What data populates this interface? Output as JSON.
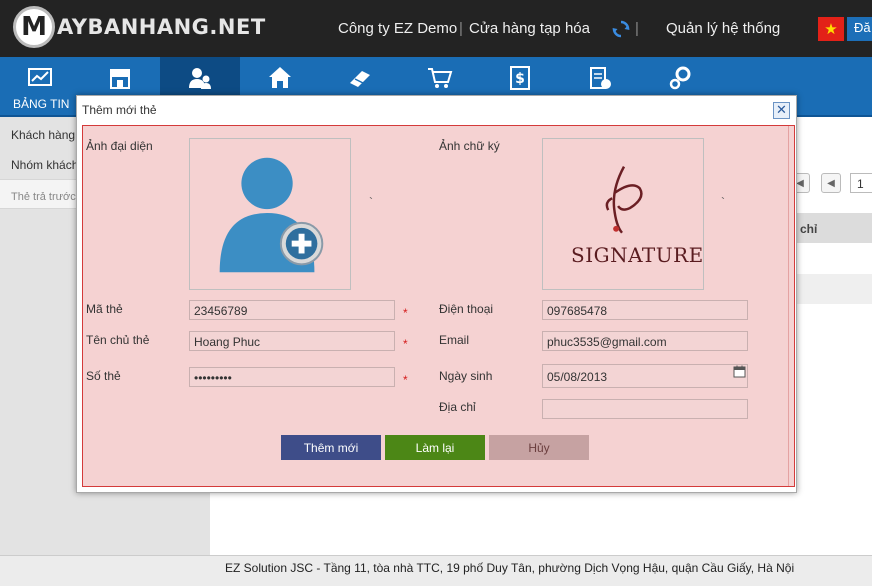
{
  "header": {
    "logo_m": "M",
    "logo_text": "AYBANHANG.NET",
    "company": "Công ty EZ Demo",
    "store": "Cửa hàng tạp hóa",
    "admin": "Quản lý hệ thống",
    "separator": "|",
    "login_label": "Đă"
  },
  "nav": {
    "first_label": "BẢNG TIN",
    "icons": [
      "dashboard-icon",
      "store-icon",
      "customers-icon",
      "home-icon",
      "products-icon",
      "cart-icon",
      "money-icon",
      "report-icon",
      "settings-icon"
    ]
  },
  "sidebar": {
    "items": [
      "Khách hàng",
      "Nhóm khách",
      "Thẻ trả trước"
    ]
  },
  "table": {
    "header_fragment": "a chỉ",
    "pager_first": "◀",
    "pager_prev": "◀",
    "page_number": "1"
  },
  "modal": {
    "title": "Thêm mới thẻ",
    "close": "✕",
    "avatar_label": "Ảnh đại diện",
    "signature_label": "Ảnh chữ ký",
    "tick": "`",
    "signature_text": "SIGNATURE",
    "fields": {
      "card_code_label": "Mã thẻ",
      "card_code_value": "23456789",
      "holder_label": "Tên chủ thẻ",
      "holder_value": "Hoang Phuc",
      "card_number_label": "Số thẻ",
      "card_number_value": "•••••••••",
      "phone_label": "Điện thoại",
      "phone_value": "097685478",
      "email_label": "Email",
      "email_value": "phuc3535@gmail.com",
      "dob_label": "Ngày sinh",
      "dob_value": "05/08/2013",
      "address_label": "Địa chỉ",
      "address_value": "",
      "required_mark": "*"
    },
    "buttons": {
      "add": "Thêm mới",
      "reset": "Làm lại",
      "cancel": "Hủy"
    }
  },
  "footer": {
    "text": "EZ Solution JSC - Tầng 11, tòa nhà TTC, 19 phố Duy Tân, phường Dịch Vọng Hậu, quận Cầu Giấy, Hà Nội"
  },
  "colors": {
    "topbar": "#232323",
    "nav": "#1a6db5",
    "nav_active": "#0d4b84",
    "form_bg": "#f5d2d2",
    "form_border": "#d43a3a",
    "btn_add": "#3e4d89",
    "btn_reset": "#4c8716",
    "btn_cancel": "#c6a2a2"
  }
}
